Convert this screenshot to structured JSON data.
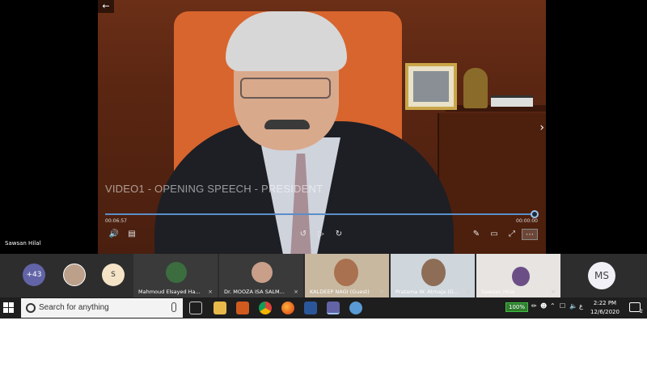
{
  "video": {
    "title": "VIDEO1 - OPENING SPEECH - PRESIDENT",
    "elapsed": "00:06:57",
    "duration": "00:00:00",
    "progress": 1.0
  },
  "speaker": {
    "name": "Sawsan Hilal"
  },
  "participants": {
    "overflow": "+43",
    "avatar_initial": "S",
    "tiles": [
      {
        "label": "Mahmoud Elsayed Ha..."
      },
      {
        "label": "Dr. MOOZA ISA SALM..."
      },
      {
        "label": "KALDEEP NAGI (Guest)"
      },
      {
        "label": "Pratama W. Atmaja (G..."
      },
      {
        "label": "Sawsan Hilal"
      }
    ],
    "ms_initials": "MS"
  },
  "taskbar": {
    "search_placeholder": "Search for anything",
    "battery": "100%",
    "time": "2:22 PM",
    "date": "12/6/2020",
    "lang": "ع",
    "notifications": "2"
  },
  "colors": {
    "progress": "#5b8ec9",
    "teams_purple": "#6264a7",
    "taskbar": "#1e1e1e"
  }
}
